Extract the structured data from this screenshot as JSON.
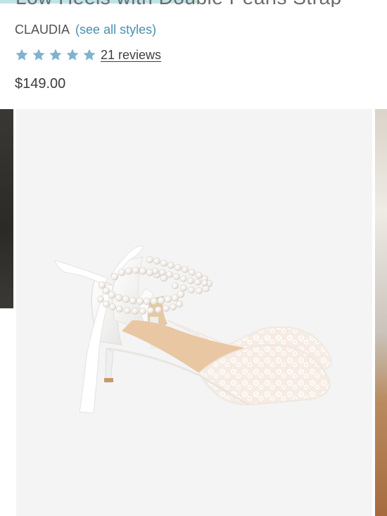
{
  "product": {
    "title_partial": "Low Heels with Double Pearls Strap",
    "vendor": "CLAUDIA",
    "styles_link": "(see all styles)",
    "rating": {
      "stars": 5,
      "max": 5,
      "reviews_label": "21 reviews"
    },
    "price": "$149.00"
  },
  "gallery": {
    "main_image": "white-lace-pointed-heel-with-pearl-ankle-straps-and-satin-ribbon",
    "prev_slide": "dark-photo-partial",
    "next_slide": "interior-photo-partial"
  },
  "colors": {
    "star": "#7fb3d0",
    "link": "#4a8fb2",
    "accent_bar": "#bfe3e6"
  }
}
